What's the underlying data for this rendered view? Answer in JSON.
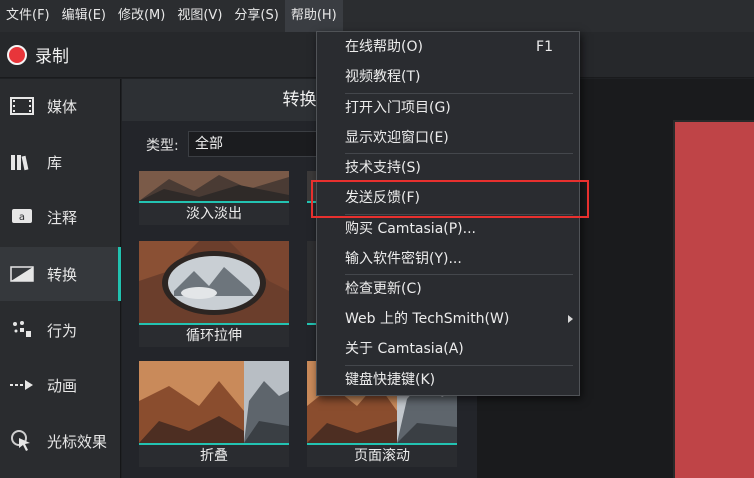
{
  "menubar": {
    "items": [
      "文件(F)",
      "编辑(E)",
      "修改(M)",
      "视图(V)",
      "分享(S)",
      "帮助(H)"
    ]
  },
  "record": {
    "label": "录制"
  },
  "sidebar": {
    "items": [
      {
        "label": "媒体",
        "icon": "film-icon"
      },
      {
        "label": "库",
        "icon": "library-books-icon"
      },
      {
        "label": "注释",
        "icon": "annotation-callout-icon"
      },
      {
        "label": "转换",
        "icon": "transition-icon",
        "active": true
      },
      {
        "label": "行为",
        "icon": "behavior-icon"
      },
      {
        "label": "动画",
        "icon": "animation-arrow-icon"
      },
      {
        "label": "光标效果",
        "icon": "cursor-effect-icon"
      }
    ]
  },
  "panel": {
    "title": "转换",
    "type_label": "类型:",
    "type_value": "全部",
    "tiles": [
      {
        "label": "淡入淡出"
      },
      {
        "label": "循环拉伸"
      },
      {
        "label": "折叠"
      },
      {
        "label": "页面滚动"
      }
    ]
  },
  "help_menu": {
    "items": [
      {
        "label": "在线帮助(O)",
        "shortcut": "F1"
      },
      {
        "label": "视频教程(T)"
      },
      {
        "label": "打开入门项目(G)"
      },
      {
        "label": "显示欢迎窗口(E)"
      },
      {
        "label": "技术支持(S)"
      },
      {
        "label": "发送反馈(F)",
        "highlighted": true
      },
      {
        "label": "购买 Camtasia(P)..."
      },
      {
        "label": "输入软件密钥(Y)..."
      },
      {
        "label": "检查更新(C)"
      },
      {
        "label": "Web 上的 TechSmith(W)",
        "submenu": true
      },
      {
        "label": "关于 Camtasia(A)"
      },
      {
        "label": "键盘快捷键(K)"
      }
    ]
  },
  "colors": {
    "accent": "#23c3b2",
    "record": "#e8353a",
    "highlight_box": "#e8302e",
    "canvas": "#bf4447"
  }
}
